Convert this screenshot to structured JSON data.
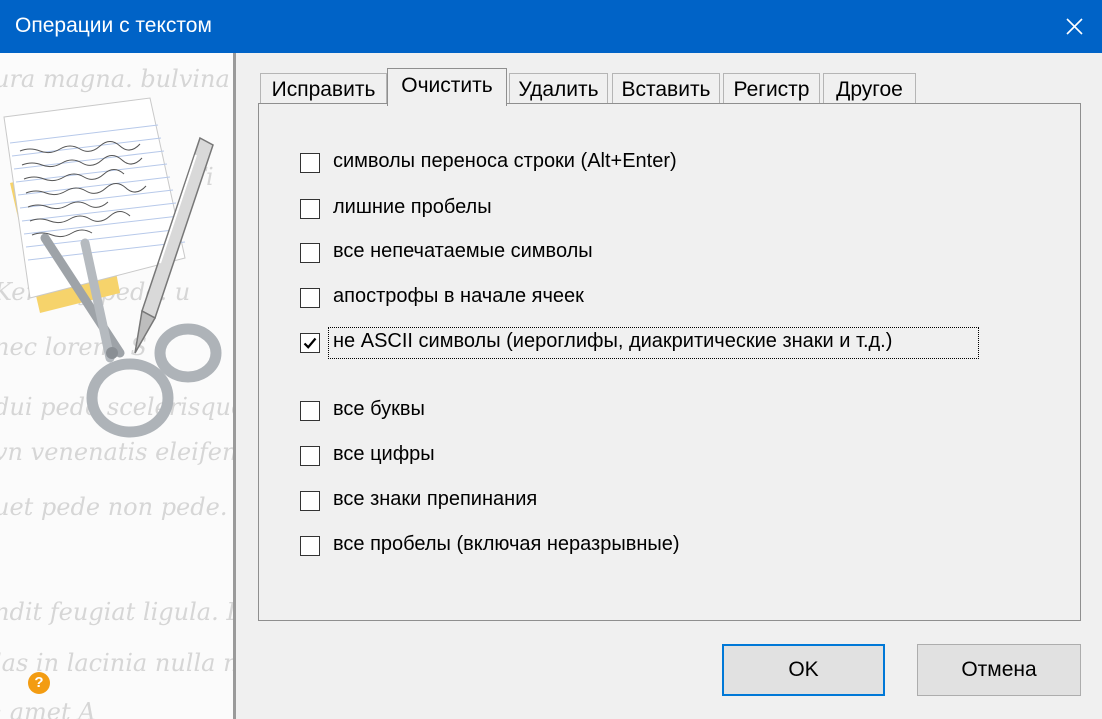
{
  "window": {
    "title": "Операции с текстом"
  },
  "tabs": [
    {
      "label": "Исправить",
      "active": false
    },
    {
      "label": "Очистить",
      "active": true
    },
    {
      "label": "Удалить",
      "active": false
    },
    {
      "label": "Вставить",
      "active": false
    },
    {
      "label": "Регистр",
      "active": false
    },
    {
      "label": "Другое",
      "active": false
    }
  ],
  "options": [
    {
      "label": "символы переноса строки (Alt+Enter)",
      "checked": false
    },
    {
      "label": "лишние пробелы",
      "checked": false
    },
    {
      "label": "все непечатаемые символы",
      "checked": false
    },
    {
      "label": "апострофы в начале ячеек",
      "checked": false
    },
    {
      "label": "не ASCII символы (иероглифы, диакритические знаки и т.д.)",
      "checked": true
    },
    {
      "label": "все буквы",
      "checked": false
    },
    {
      "label": "все цифры",
      "checked": false
    },
    {
      "label": "все знаки препинания",
      "checked": false
    },
    {
      "label": "все пробелы (включая неразрывные)",
      "checked": false
    }
  ],
  "buttons": {
    "ok": "OK",
    "cancel": "Отмена"
  },
  "help": {
    "glyph": "?"
  },
  "colors": {
    "titlebar": "#0063c7",
    "accent": "#0078d7",
    "help": "#f39c12"
  }
}
